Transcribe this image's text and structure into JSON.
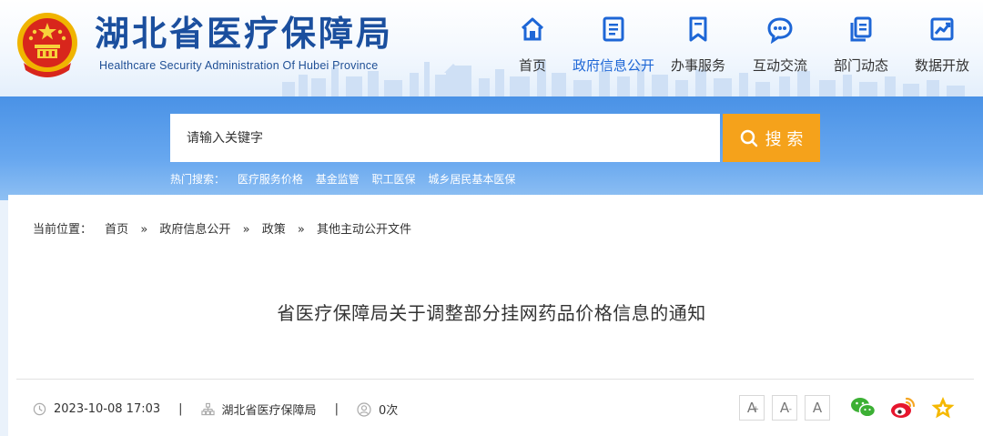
{
  "site": {
    "title": "湖北省医疗保障局",
    "subtitle": "Healthcare Security Administration Of Hubei Province"
  },
  "nav": [
    {
      "label": "首页",
      "icon": "home-icon",
      "active": false
    },
    {
      "label": "政府信息公开",
      "icon": "document-icon",
      "active": true
    },
    {
      "label": "办事服务",
      "icon": "bookmark-icon",
      "active": false
    },
    {
      "label": "互动交流",
      "icon": "chat-icon",
      "active": false
    },
    {
      "label": "部门动态",
      "icon": "copy-icon",
      "active": false
    },
    {
      "label": "数据开放",
      "icon": "chart-icon",
      "active": false
    }
  ],
  "search": {
    "placeholder": "请输入关键字",
    "button_label": "搜 索"
  },
  "hot_search": {
    "label": "热门搜索：",
    "links": [
      "医疗服务价格",
      "基金监管",
      "职工医保",
      "城乡居民基本医保"
    ]
  },
  "breadcrumb": {
    "label": "当前位置：",
    "items": [
      "首页",
      "政府信息公开",
      "政策",
      "其他主动公开文件"
    ],
    "separator": "»"
  },
  "article": {
    "title": "省医疗保障局关于调整部分挂网药品价格信息的通知",
    "date": "2023-10-08 17:03",
    "source": "湖北省医疗保障局",
    "views": "0次",
    "meta_separator": "|"
  },
  "font_tools": {
    "large": "A",
    "large_sup": "+",
    "small": "A",
    "small_sup": "-",
    "normal": "A"
  },
  "colors": {
    "brand_blue": "#1b4f9e",
    "nav_active": "#1d66d6",
    "search_button": "#f5a21b",
    "band_blue": "#5a9deb",
    "wechat_green": "#3cb034",
    "weibo_red": "#e6162d",
    "weibo_orange": "#f5a623",
    "favorite_yellow": "#f5b800"
  }
}
